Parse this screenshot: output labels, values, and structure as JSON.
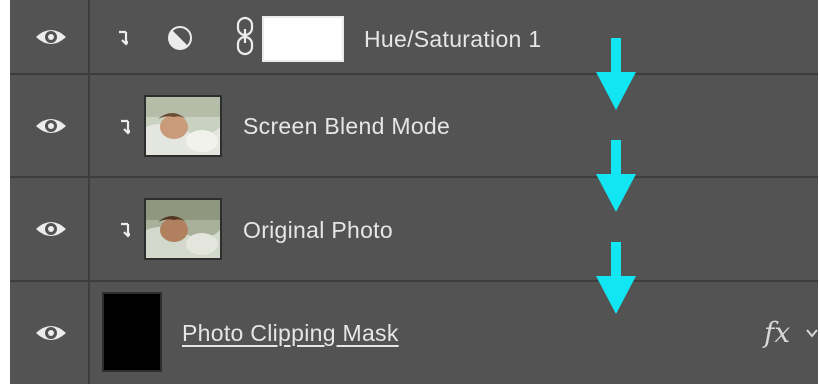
{
  "layers": [
    {
      "name": "Hue/Saturation 1",
      "type": "adjustment",
      "clipped": true
    },
    {
      "name": "Screen Blend Mode",
      "type": "photo",
      "clipped": true
    },
    {
      "name": "Original Photo",
      "type": "photo",
      "clipped": true
    },
    {
      "name": "Photo Clipping Mask",
      "type": "black-fill",
      "clipped": false,
      "underlined": true
    }
  ],
  "fx_label": "fx",
  "icons": {
    "visibility": "eye-icon",
    "clip": "clipping-arrow-icon",
    "adjustment": "hue-saturation-icon",
    "link": "chain-link-icon",
    "flow": "down-arrow-icon",
    "effects": "chevron-down-icon"
  },
  "colors": {
    "panel": "#535353",
    "divider": "#3d3d3d",
    "text": "#e6e6e6",
    "annotation_arrow": "#12e6f2",
    "mask_fill": "#000000"
  }
}
